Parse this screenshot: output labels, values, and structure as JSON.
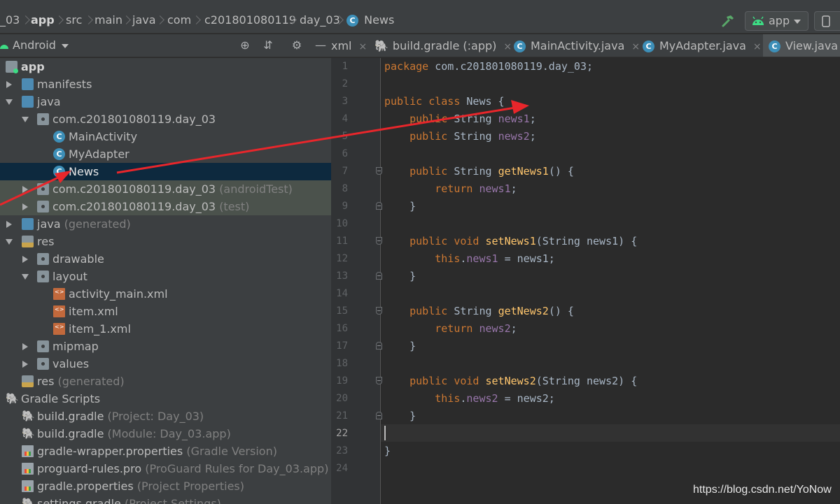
{
  "breadcrumb": [
    "_03",
    "app",
    "src",
    "main",
    "java",
    "com",
    "c201801080119",
    "day_03",
    "News"
  ],
  "toolbar": {
    "run_config": "app"
  },
  "project_panel": {
    "title": "Android"
  },
  "tabs": [
    {
      "label": "xml",
      "close": "×"
    },
    {
      "label": "build.gradle (:app)",
      "close": "×"
    },
    {
      "label": "MainActivity.java",
      "close": "×"
    },
    {
      "label": "MyAdapter.java",
      "close": "×"
    },
    {
      "label": "View.java",
      "close": "×"
    }
  ],
  "tree": [
    {
      "label": "app",
      "hint": ""
    },
    {
      "label": "manifests",
      "hint": ""
    },
    {
      "label": "java",
      "hint": ""
    },
    {
      "label": "com.c201801080119.day_03",
      "hint": ""
    },
    {
      "label": "MainActivity",
      "hint": ""
    },
    {
      "label": "MyAdapter",
      "hint": ""
    },
    {
      "label": "News",
      "hint": ""
    },
    {
      "label": "com.c201801080119.day_03",
      "hint": "(androidTest)"
    },
    {
      "label": "com.c201801080119.day_03",
      "hint": "(test)"
    },
    {
      "label": "java",
      "hint": "(generated)"
    },
    {
      "label": "res",
      "hint": ""
    },
    {
      "label": "drawable",
      "hint": ""
    },
    {
      "label": "layout",
      "hint": ""
    },
    {
      "label": "activity_main.xml",
      "hint": ""
    },
    {
      "label": "item.xml",
      "hint": ""
    },
    {
      "label": "item_1.xml",
      "hint": ""
    },
    {
      "label": "mipmap",
      "hint": ""
    },
    {
      "label": "values",
      "hint": ""
    },
    {
      "label": "res",
      "hint": "(generated)"
    },
    {
      "label": "Gradle Scripts",
      "hint": ""
    },
    {
      "label": "build.gradle",
      "hint": "(Project: Day_03)"
    },
    {
      "label": "build.gradle",
      "hint": "(Module: Day_03.app)"
    },
    {
      "label": "gradle-wrapper.properties",
      "hint": "(Gradle Version)"
    },
    {
      "label": "proguard-rules.pro",
      "hint": "(ProGuard Rules for Day_03.app)"
    },
    {
      "label": "gradle.properties",
      "hint": "(Project Properties)"
    },
    {
      "label": "settings.gradle",
      "hint": "(Project Settings)"
    }
  ],
  "editor": {
    "line_numbers": [
      "1",
      "2",
      "3",
      "4",
      "5",
      "6",
      "7",
      "8",
      "9",
      "10",
      "11",
      "12",
      "13",
      "14",
      "15",
      "16",
      "17",
      "18",
      "19",
      "20",
      "21",
      "22",
      "23",
      "24"
    ],
    "current_line": 22,
    "lines": [
      [
        [
          "kw",
          "package "
        ],
        [
          "p",
          "com.c201801080119.day_03;"
        ]
      ],
      [],
      [
        [
          "kw",
          "public class "
        ],
        [
          "p",
          "News {"
        ]
      ],
      [
        [
          "p",
          "    "
        ],
        [
          "kw",
          "public "
        ],
        [
          "p",
          "String "
        ],
        [
          "fld",
          "news1"
        ],
        [
          "p",
          ";"
        ]
      ],
      [
        [
          "p",
          "    "
        ],
        [
          "kw",
          "public "
        ],
        [
          "p",
          "String "
        ],
        [
          "fld",
          "news2"
        ],
        [
          "p",
          ";"
        ]
      ],
      [],
      [
        [
          "p",
          "    "
        ],
        [
          "kw",
          "public "
        ],
        [
          "p",
          "String "
        ],
        [
          "fn",
          "getNews1"
        ],
        [
          "p",
          "() {"
        ]
      ],
      [
        [
          "p",
          "        "
        ],
        [
          "kw",
          "return "
        ],
        [
          "fld",
          "news1"
        ],
        [
          "p",
          ";"
        ]
      ],
      [
        [
          "p",
          "    }"
        ]
      ],
      [],
      [
        [
          "p",
          "    "
        ],
        [
          "kw",
          "public void "
        ],
        [
          "fn",
          "setNews1"
        ],
        [
          "p",
          "(String news1) {"
        ]
      ],
      [
        [
          "p",
          "        "
        ],
        [
          "kw",
          "this"
        ],
        [
          "p",
          "."
        ],
        [
          "fld",
          "news1"
        ],
        [
          "p",
          " = news1;"
        ]
      ],
      [
        [
          "p",
          "    }"
        ]
      ],
      [],
      [
        [
          "p",
          "    "
        ],
        [
          "kw",
          "public "
        ],
        [
          "p",
          "String "
        ],
        [
          "fn",
          "getNews2"
        ],
        [
          "p",
          "() {"
        ]
      ],
      [
        [
          "p",
          "        "
        ],
        [
          "kw",
          "return "
        ],
        [
          "fld",
          "news2"
        ],
        [
          "p",
          ";"
        ]
      ],
      [
        [
          "p",
          "    }"
        ]
      ],
      [],
      [
        [
          "p",
          "    "
        ],
        [
          "kw",
          "public void "
        ],
        [
          "fn",
          "setNews2"
        ],
        [
          "p",
          "(String news2) {"
        ]
      ],
      [
        [
          "p",
          "        "
        ],
        [
          "kw",
          "this"
        ],
        [
          "p",
          "."
        ],
        [
          "fld",
          "news2"
        ],
        [
          "p",
          " = news2;"
        ]
      ],
      [
        [
          "p",
          "    }"
        ]
      ],
      [],
      [
        [
          "p",
          "}"
        ]
      ],
      []
    ]
  },
  "watermark": "https://blog.csdn.net/YoNow",
  "colors": {
    "annotation_arrow": "#e8262b",
    "selection": "#0d293e",
    "test_row": "#4b524c"
  }
}
